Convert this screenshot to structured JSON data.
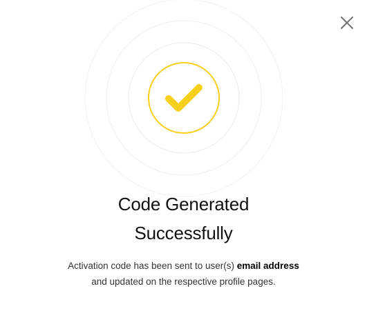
{
  "dialog": {
    "title_line1": "Code Generated",
    "title_line2": "Successfully",
    "message_part1": "Activation code has been sent to user(s) ",
    "message_bold": "email address",
    "message_part2": "and updated on the respective profile pages."
  },
  "icons": {
    "close": "close-icon",
    "success": "check-circle-icon"
  },
  "colors": {
    "accent": "#F7CF1D",
    "ring": "#EFEFEF",
    "close": "#6E6E6E",
    "title": "#111111",
    "text": "#333333"
  }
}
